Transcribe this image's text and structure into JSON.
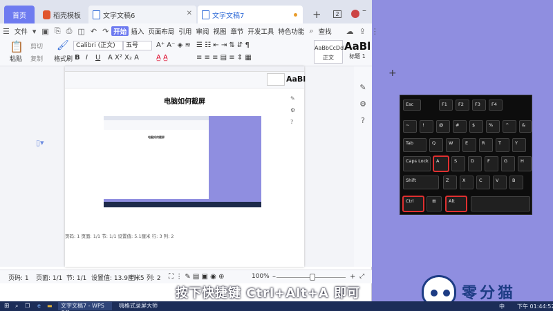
{
  "tabs": {
    "home": "首页",
    "t1": "稻壳模板",
    "t2": "文字文稿6",
    "t3": "文字文稿7",
    "badge": "2"
  },
  "menu": {
    "file": "文件",
    "items": [
      "开始",
      "插入",
      "页面布局",
      "引用",
      "审阅",
      "视图",
      "章节",
      "开发工具",
      "特色功能"
    ],
    "search": "查找"
  },
  "ribbon": {
    "paste": "粘贴",
    "cut": "剪切",
    "copy": "复制",
    "format_painter": "格式刷",
    "font_name": "Calibri (正文)",
    "font_size": "五号",
    "style1_preview": "AaBbCcDd",
    "style1_name": "正文",
    "style2_preview": "AaBl",
    "style2_name": "标题 1"
  },
  "document": {
    "title": "电脑如何截屏",
    "inner_status": "页码: 1   页面: 1/1   节: 1/1   设置值: 5.1厘米   行: 3   列: 2"
  },
  "status": {
    "page_num": "页码: 1",
    "page": "页面: 1/1",
    "section": "节: 1/1",
    "set_value": "设置值: 13.9厘米",
    "row": "行: 5",
    "col": "列: 2",
    "zoom": "100%"
  },
  "keyboard": {
    "keys": [
      "Esc",
      "F1",
      "F2",
      "F3",
      "F4",
      "!",
      "@",
      "#",
      "$",
      "%",
      "Tab",
      "Q",
      "W",
      "E",
      "R",
      "Caps Lock",
      "A",
      "S",
      "D",
      "F",
      "Shift",
      "Z",
      "X",
      "C",
      "V",
      "Ctrl",
      "Alt"
    ]
  },
  "caption": "按下快捷键 Ctrl+Alt+A 即可",
  "brand": "零分猫",
  "taskbar": {
    "app1": "文字文稿7 - WPS Off...",
    "app2": "嗨格式录屏大师",
    "ime": "中",
    "time": "下午 01:44:52"
  }
}
